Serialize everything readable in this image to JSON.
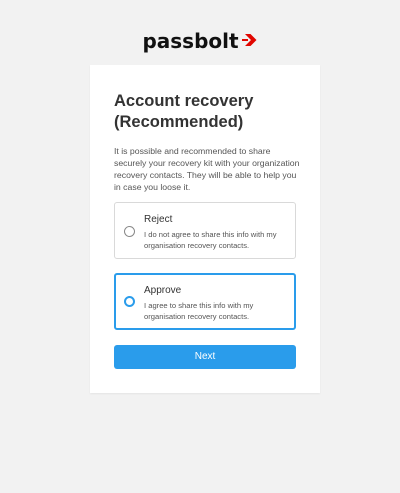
{
  "brand": {
    "name": "passbolt",
    "logo_icon": "passbolt-arrow-logo-icon",
    "accent_color": "#e10600"
  },
  "card": {
    "title": "Account recovery (Recommended)",
    "description": "It is possible and recommended to share securely your recovery kit with your organization recovery contacts. They will be able to help you in case you loose it."
  },
  "options": [
    {
      "name": "Reject",
      "description": "I do not agree to share this info with my organisation recovery contacts.",
      "selected": false
    },
    {
      "name": "Approve",
      "description": "I agree to share this info with my organisation recovery contacts.",
      "selected": true
    }
  ],
  "actions": {
    "next_label": "Next",
    "primary_color": "#2a9ceb"
  }
}
